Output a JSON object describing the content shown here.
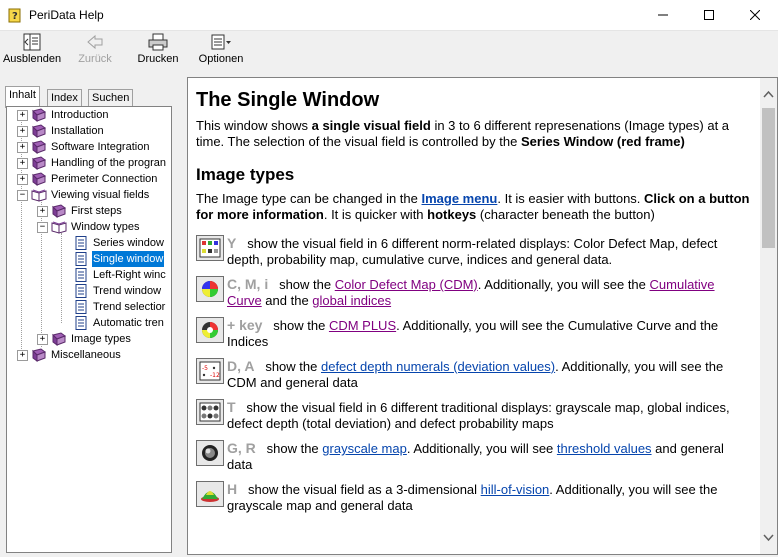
{
  "window": {
    "title": "PeriData Help"
  },
  "toolbar": {
    "hide": "Ausblenden",
    "back": "Zurück",
    "print": "Drucken",
    "options": "Optionen"
  },
  "tabs": {
    "contents": "Inhalt",
    "index": "Index",
    "search": "Suchen"
  },
  "tree": {
    "introduction": "Introduction",
    "installation": "Installation",
    "software_integration": "Software Integration",
    "handling": "Handling of the progran",
    "perimeter_connection": "Perimeter Connection",
    "viewing": "Viewing visual fields",
    "first_steps": "First steps",
    "window_types": "Window types",
    "series_window": "Series window",
    "single_window": "Single window",
    "left_right": "Left-Right winc",
    "trend_window": "Trend window",
    "trend_selection": "Trend selectior",
    "automatic_trend": "Automatic tren",
    "image_types": "Image types",
    "misc": "Miscellaneous"
  },
  "doc": {
    "title": "The Single Window",
    "intro": {
      "t1": "This window shows ",
      "b1": "a single visual field",
      "t2": " in 3 to 6 different represenations (Image types) at a time. The selection of the visual field is controlled by the ",
      "b2": "Series Window (red frame)"
    },
    "h2": "Image types",
    "p2": {
      "t1": "The Image type can be changed in the ",
      "link": "Image menu",
      "t2": ". It is easier with buttons. ",
      "b1": "Click on a button for more information",
      "t3": ". It is quicker with ",
      "b2": "hotkeys",
      "t4": " (character beneath the button)"
    },
    "items": [
      {
        "key": "Y",
        "text": "show the visual field in 6 different norm-related displays: Color Defect Map, defect depth, probability map, cumulative curve, indices and general data."
      },
      {
        "key": "C, M, i",
        "t1": "show the ",
        "l1": "Color Defect Map (CDM)",
        "t2": ". Additionally, you will see the ",
        "l2": "Cumulative Curve",
        "t3": " and the ",
        "l3": "global indices"
      },
      {
        "key": "+ key",
        "t1": "show the ",
        "l1": "CDM PLUS",
        "t2": ". Additionally, you will see the Cumulative Curve and the Indices"
      },
      {
        "key": "D, A",
        "t1": "show the ",
        "l1": "defect depth numerals (deviation values)",
        "t2": ". Additionally, you will see the CDM and general data"
      },
      {
        "key": "T",
        "text": "show the visual field in 6 different traditional displays: grayscale map, global indices, defect depth (total deviation) and defect probability maps"
      },
      {
        "key": "G, R",
        "t1": "show the ",
        "l1": "grayscale map",
        "t2": ". Additionally, you will see ",
        "l2": "threshold values",
        "t3": " and general data"
      },
      {
        "key": "H",
        "t1": "show the visual field as a 3-dimensional ",
        "l1": "hill-of-vision",
        "t2": ". Additionally, you will see the grayscale map and general data"
      }
    ]
  }
}
